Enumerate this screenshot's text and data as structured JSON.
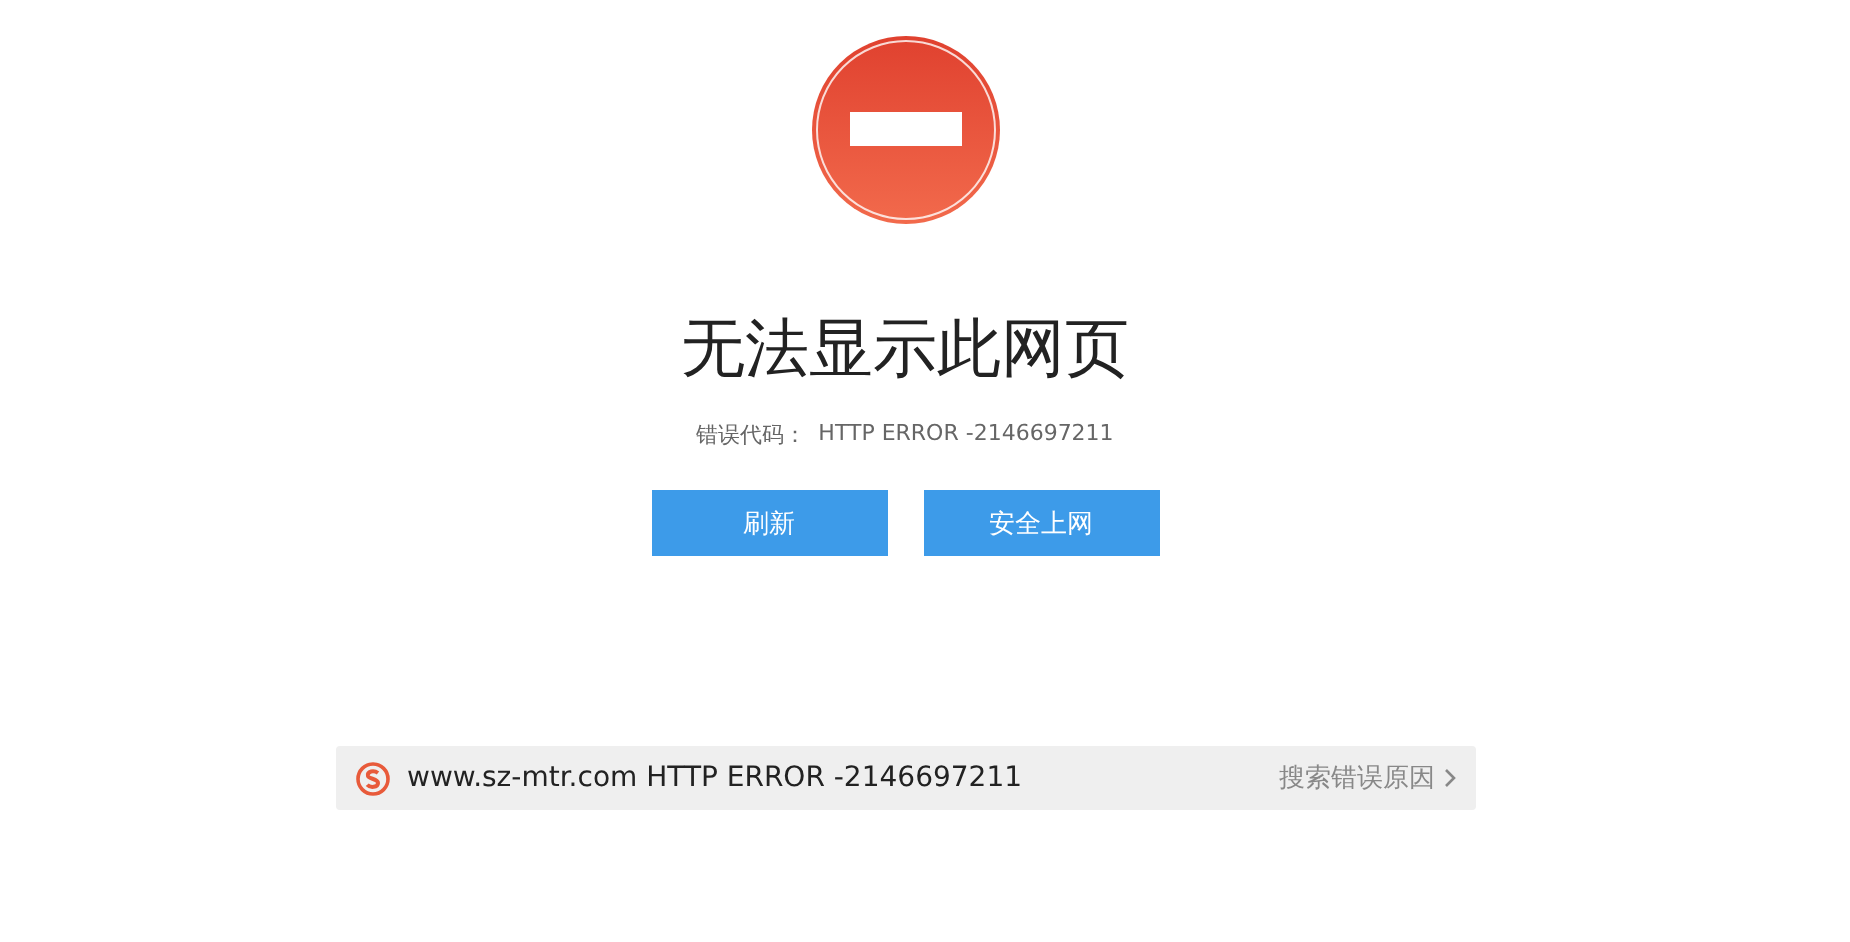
{
  "title": "无法显示此网页",
  "error": {
    "label": "错误代码：",
    "code": "HTTP ERROR -2146697211"
  },
  "buttons": [
    {
      "label": "刷新"
    },
    {
      "label": "安全上网"
    }
  ],
  "search_bar": {
    "text": "www.sz-mtr.com HTTP ERROR -2146697211",
    "link": "搜索错误原因"
  }
}
